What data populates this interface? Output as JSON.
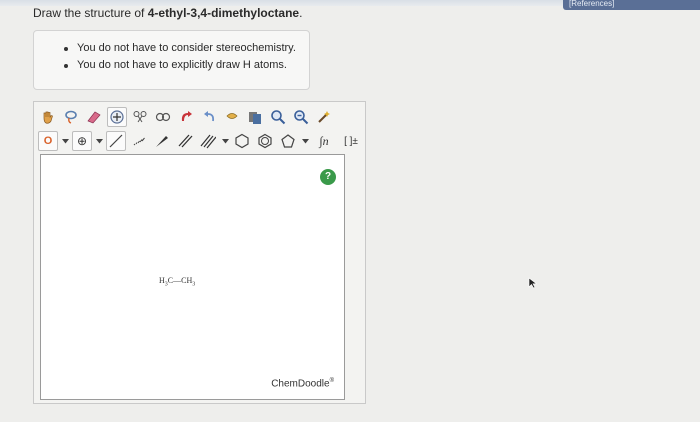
{
  "header": {
    "references_tab": "[References]"
  },
  "question": {
    "prefix": "Draw the structure of ",
    "compound": "4-ethyl-3,4-dimethyloctane",
    "suffix": "."
  },
  "notes": [
    "You do not have to consider stereochemistry.",
    "You do not have to explicitly draw H atoms."
  ],
  "toolbar": {
    "row1_icons": [
      "hand-icon",
      "lasso-icon",
      "eraser-icon",
      "zoom-in-icon",
      "cut-icon",
      "link-icon",
      "undo-icon",
      "redo-icon",
      "clean-icon",
      "copy-icon",
      "magnify-icon",
      "zoom-out-icon",
      "wand-icon"
    ],
    "atom_label": "O",
    "charge_label": "⊕",
    "template_label": "∫n",
    "bracket_label": "[ ]±"
  },
  "canvas": {
    "molecule_text": "H3C—CH3",
    "help_label": "?",
    "brand": "ChemDoodle"
  },
  "colors": {
    "accent_blue": "#5a6f96",
    "help_green": "#3a9a4a",
    "atom_orange": "#d9622b"
  }
}
